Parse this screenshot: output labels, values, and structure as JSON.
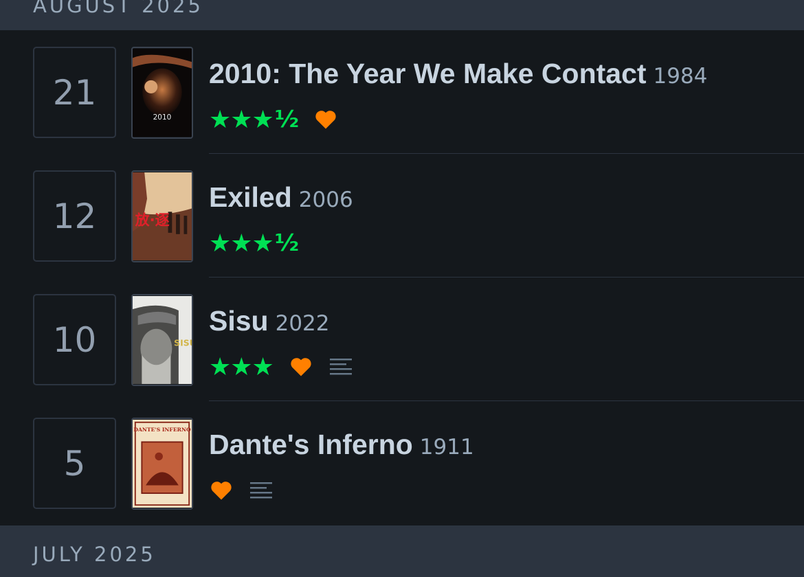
{
  "months": {
    "current": "AUGUST 2025",
    "next": "JULY 2025"
  },
  "colors": {
    "star": "#00e054",
    "heart": "#ff8000",
    "background": "#14181c",
    "header_bg": "#2c3440"
  },
  "entries": [
    {
      "day": "21",
      "title": "2010: The Year We Make Contact",
      "year": "1984",
      "rating": 3.5,
      "stars": "★★★",
      "half": "½",
      "liked": true,
      "has_review": false,
      "poster_text": "2010"
    },
    {
      "day": "12",
      "title": "Exiled",
      "year": "2006",
      "rating": 3.5,
      "stars": "★★★",
      "half": "½",
      "liked": false,
      "has_review": false,
      "poster_text": "放·逐"
    },
    {
      "day": "10",
      "title": "Sisu",
      "year": "2022",
      "rating": 3,
      "stars": "★★★",
      "half": "",
      "liked": true,
      "has_review": true,
      "poster_text": "SISU"
    },
    {
      "day": "5",
      "title": "Dante's Inferno",
      "year": "1911",
      "rating": null,
      "stars": "",
      "half": "",
      "liked": true,
      "has_review": true,
      "poster_text": "DANTE'S INFERNO"
    }
  ],
  "icons": {
    "heart": "heart-icon",
    "review": "review-text-icon",
    "star": "star-icon"
  }
}
